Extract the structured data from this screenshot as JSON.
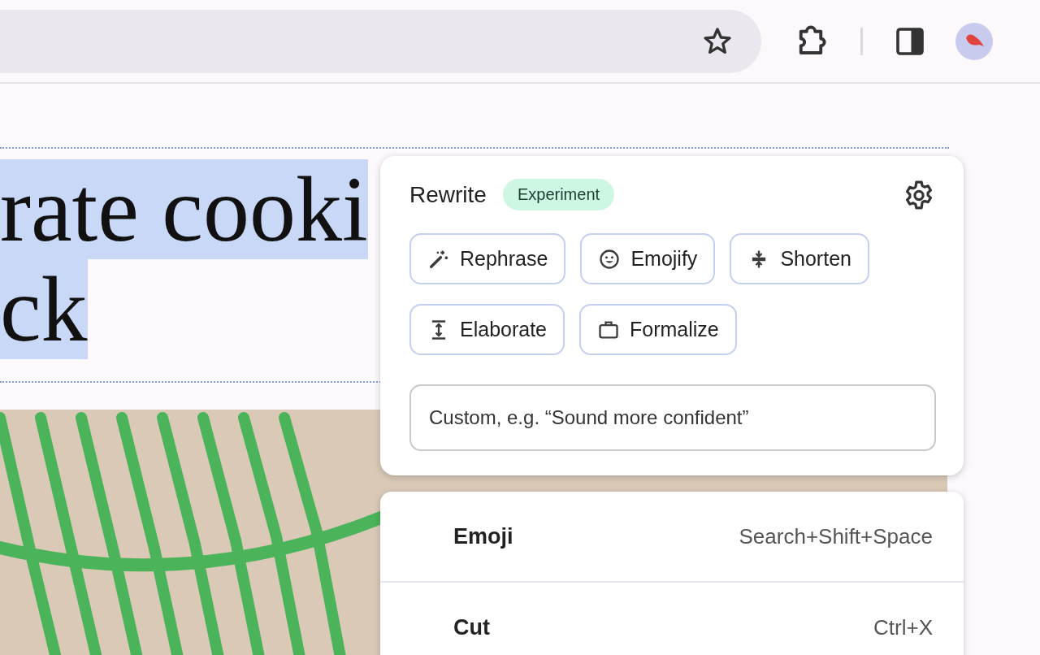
{
  "heading": {
    "lines": [
      "rate cooki",
      "ck"
    ],
    "selected": true
  },
  "rewrite_panel": {
    "title": "Rewrite",
    "badge": "Experiment",
    "options": [
      {
        "label": "Rephrase"
      },
      {
        "label": "Emojify"
      },
      {
        "label": "Shorten"
      },
      {
        "label": "Elaborate"
      },
      {
        "label": "Formalize"
      }
    ],
    "custom_field": {
      "placeholder": "Custom, e.g. “Sound more confident”"
    }
  },
  "context_menu": {
    "items": [
      {
        "label": "Emoji",
        "shortcut": "Search+Shift+Space"
      },
      {
        "label": "Cut",
        "shortcut": "Ctrl+X"
      }
    ]
  }
}
